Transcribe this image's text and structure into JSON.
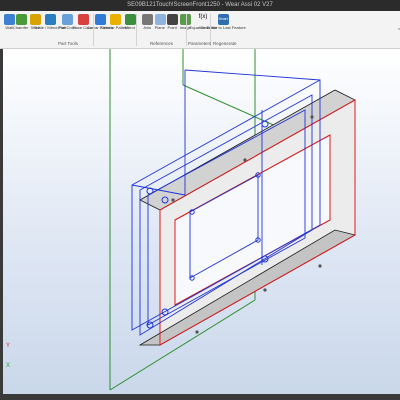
{
  "window": {
    "title": "SE09B121Touch!ScreenFront1250 - Wear Assi 02 V27"
  },
  "ribbon": {
    "buttons": [
      {
        "id": "wall",
        "label": "Wall",
        "color": "#3d7fd0"
      },
      {
        "id": "chamfer",
        "label": "Chamfer",
        "color": "#4a9a3a"
      },
      {
        "id": "shell",
        "label": "Shell",
        "color": "#d8a200"
      },
      {
        "id": "scale-mirror",
        "label": "Scale / Mirror Part",
        "color": "#2a7fc0"
      },
      {
        "id": "part-color",
        "label": "Part Color",
        "color": "#6aa0d8"
      },
      {
        "id": "face-color",
        "label": "Face Color",
        "color": "#d94040"
      },
      {
        "id": "linear-pattern",
        "label": "Linear Pattern",
        "color": "#2f7bd6"
      },
      {
        "id": "circular-pattern",
        "label": "Circular Pattern",
        "color": "#e8b000"
      },
      {
        "id": "mirror",
        "label": "Mirror",
        "color": "#3c8f3c"
      },
      {
        "id": "axis",
        "label": "Axis",
        "color": "#777777"
      },
      {
        "id": "plane",
        "label": "Plane",
        "color": "#8fb3e0"
      },
      {
        "id": "point",
        "label": "Point",
        "color": "#444444"
      },
      {
        "id": "image",
        "label": "Image",
        "color": "#5a9b4b"
      },
      {
        "id": "equation-editor",
        "label": "Equation Editor",
        "color": "#555555"
      },
      {
        "id": "generate-last-feature",
        "label": "Generate to Last Feature",
        "color": "#2f6fb0"
      }
    ],
    "groups": [
      "Part Tools",
      "References",
      "Parameters",
      "Regenerate"
    ],
    "formula_glyph": "f(x)",
    "regen_badge": "Smart"
  },
  "viewport": {
    "background_top": "#ffffff",
    "background_bottom": "#c9d7ea",
    "axis_labels": [
      "Y",
      "X"
    ],
    "edge_colors": {
      "highlight": "#1f35d6",
      "selected": "#e01b1b",
      "reference": "#2f8f2f",
      "outline": "#1b1b1b"
    }
  }
}
